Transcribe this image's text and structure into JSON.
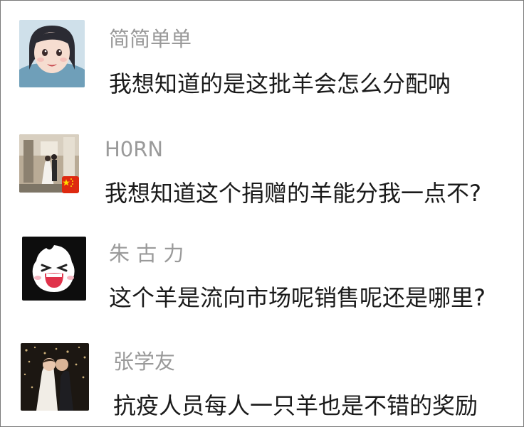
{
  "comments": [
    {
      "username": "简简单单",
      "text": "我想知道的是这批羊会怎么分配呐",
      "avatar_icon": "cartoon-girl-avatar"
    },
    {
      "username": "H0RN",
      "text": "我想知道这个捐赠的羊能分我一点不?",
      "avatar_icon": "wedding-photo-avatar",
      "badge_icon": "china-flag-icon"
    },
    {
      "username": "朱 古 力",
      "text": "这个羊是流向市场呢销售呢还是哪里?",
      "avatar_icon": "laughing-face-avatar"
    },
    {
      "username": "张学友",
      "text": "抗疫人员每人一只羊也是不错的奖励",
      "avatar_icon": "wedding-kiss-avatar"
    }
  ],
  "colors": {
    "username": "#9a9a9a",
    "text": "#1a1a1a",
    "background": "#ffffff",
    "flag_red": "#de2910",
    "flag_yellow": "#ffde00"
  }
}
